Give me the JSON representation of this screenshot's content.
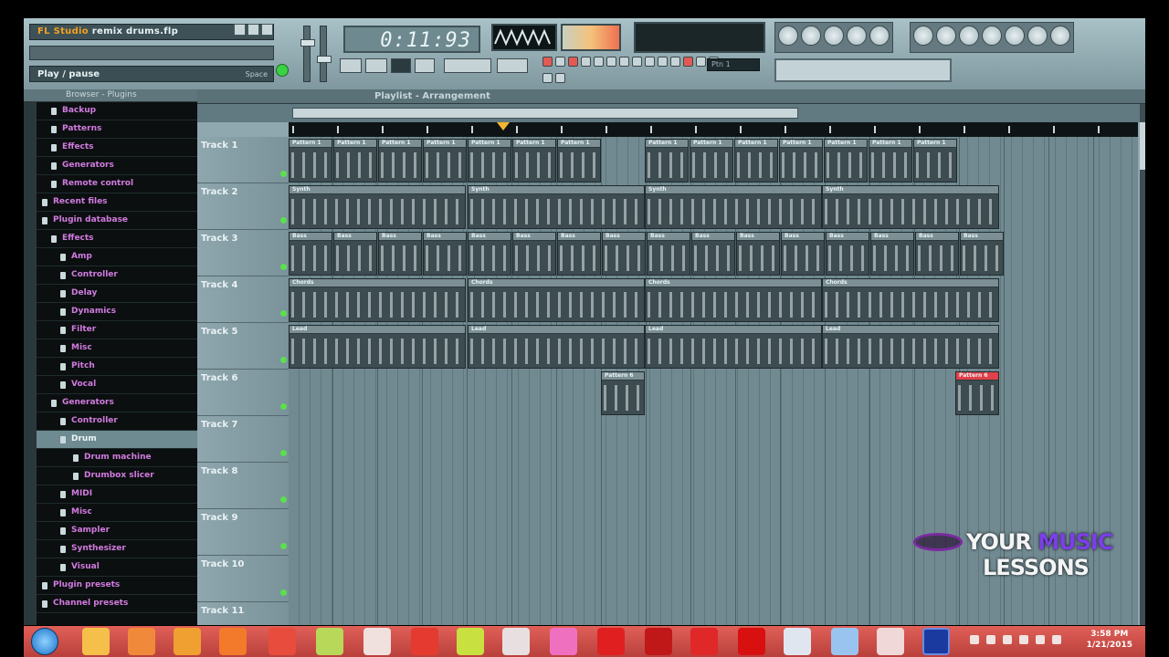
{
  "window": {
    "title_prefix": "FL Studio",
    "title_file": "remix drums.flp",
    "status_text": "Play / pause",
    "status_right": "Space",
    "time_display": "0:11:93",
    "pattern_label": "Ptn 1"
  },
  "browser": {
    "header": "Browser - Plugins",
    "items": [
      {
        "label": "Backup",
        "level": 1
      },
      {
        "label": "Patterns",
        "level": 1
      },
      {
        "label": "Effects",
        "level": 1
      },
      {
        "label": "Generators",
        "level": 1
      },
      {
        "label": "Remote control",
        "level": 1
      },
      {
        "label": "Recent files",
        "level": 0
      },
      {
        "label": "Plugin database",
        "level": 0
      },
      {
        "label": "Effects",
        "level": 1
      },
      {
        "label": "Amp",
        "level": 2
      },
      {
        "label": "Controller",
        "level": 2
      },
      {
        "label": "Delay",
        "level": 2
      },
      {
        "label": "Dynamics",
        "level": 2
      },
      {
        "label": "Filter",
        "level": 2
      },
      {
        "label": "Misc",
        "level": 2
      },
      {
        "label": "Pitch",
        "level": 2
      },
      {
        "label": "Vocal",
        "level": 2
      },
      {
        "label": "Generators",
        "level": 1
      },
      {
        "label": "Controller",
        "level": 2
      },
      {
        "label": "Drum",
        "level": 2,
        "selected": true
      },
      {
        "label": "Drum machine",
        "level": 3
      },
      {
        "label": "Drumbox slicer",
        "level": 3
      },
      {
        "label": "MIDI",
        "level": 2
      },
      {
        "label": "Misc",
        "level": 2
      },
      {
        "label": "Sampler",
        "level": 2
      },
      {
        "label": "Synthesizer",
        "level": 2
      },
      {
        "label": "Visual",
        "level": 2
      },
      {
        "label": "Plugin presets",
        "level": 0
      },
      {
        "label": "Channel presets",
        "level": 0
      }
    ]
  },
  "playlist": {
    "title": "Playlist - Arrangement",
    "tracks": [
      "Track 1",
      "Track 2",
      "Track 3",
      "Track 4",
      "Track 5",
      "Track 6",
      "Track 7",
      "Track 8",
      "Track 9",
      "Track 10",
      "Track 11"
    ],
    "clip_labels": {
      "t1": "Pattern 1",
      "t2": "Synth",
      "t3": "Bass",
      "t4": "Chords",
      "t5": "Lead",
      "t6a": "Pattern 6",
      "t6b": "Pattern 6"
    }
  },
  "watermark": {
    "word1": "YOUR",
    "word2": "MUSIC",
    "word3": "LESSONS"
  },
  "taskbar": {
    "clock_time": "3:58 PM",
    "clock_date": "1/21/2015"
  },
  "colors": {
    "accent_purple": "#d27be0",
    "marker": "#f5b52e",
    "clip_red": "#e2404a",
    "led_green": "#3ad145"
  }
}
